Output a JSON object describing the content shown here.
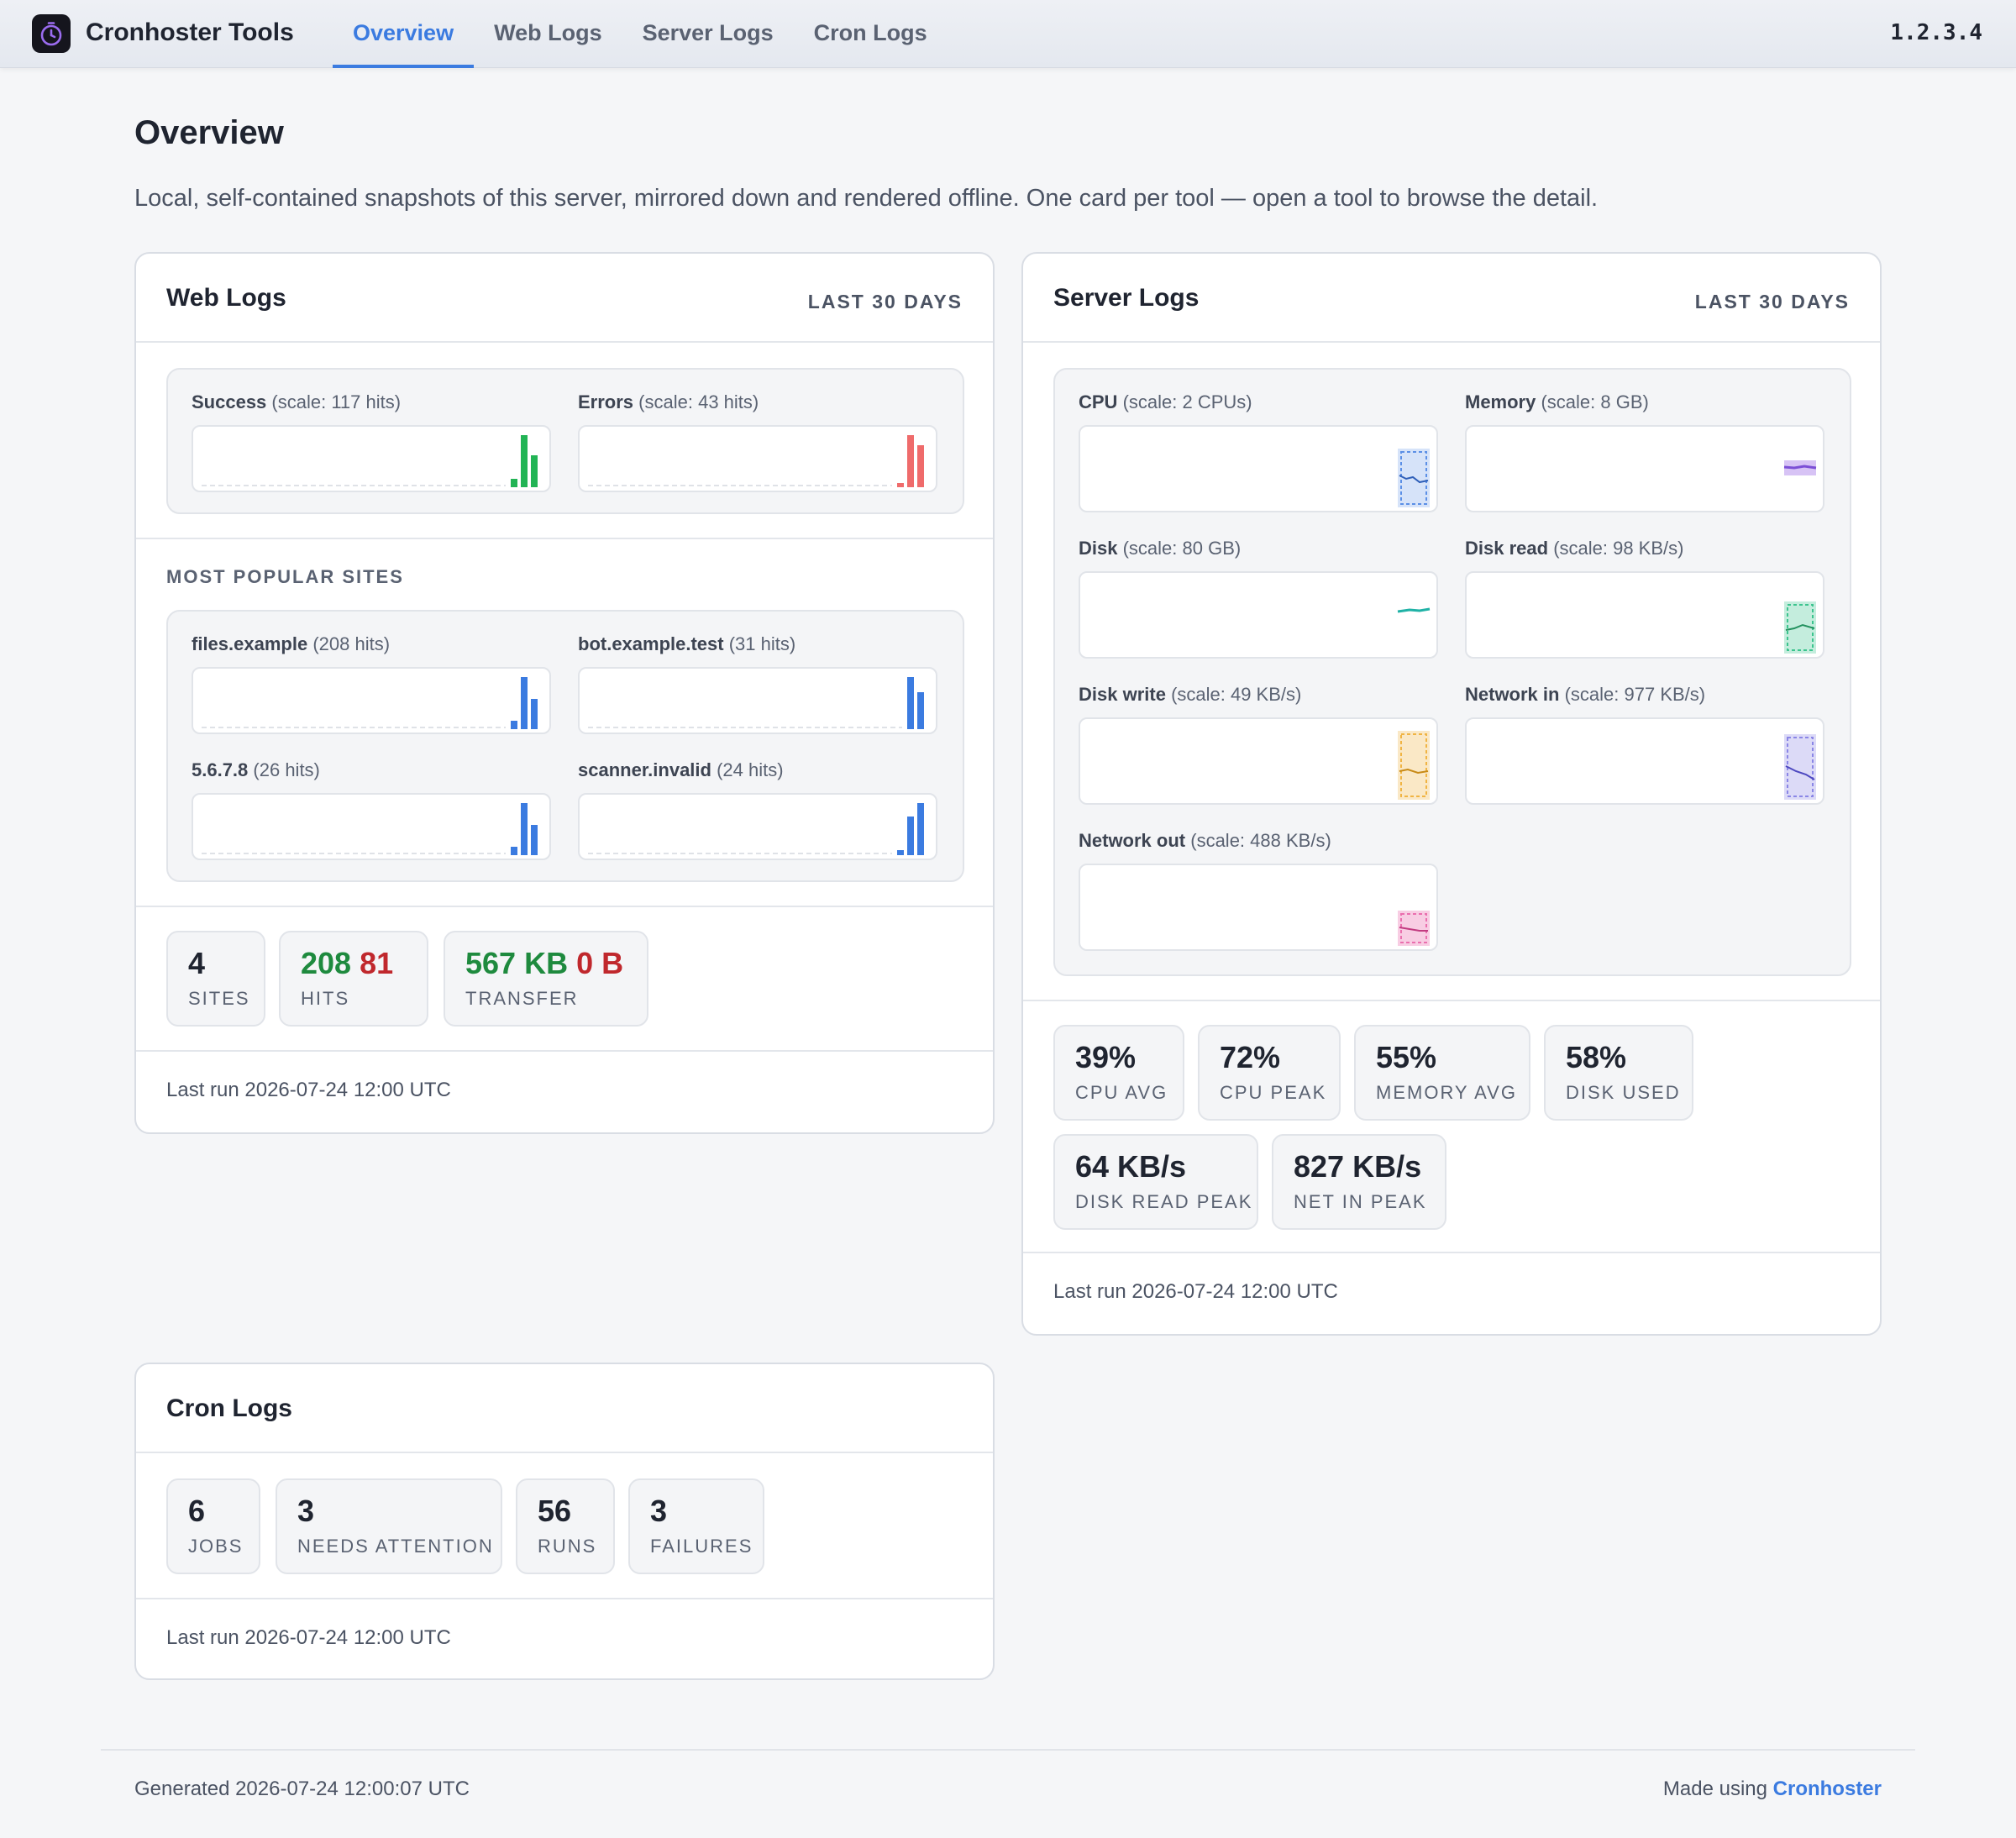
{
  "app": {
    "brand": "Cronhoster Tools",
    "version": "1.2.3.4"
  },
  "nav": {
    "tabs": [
      {
        "label": "Overview",
        "active": true
      },
      {
        "label": "Web Logs"
      },
      {
        "label": "Server Logs"
      },
      {
        "label": "Cron Logs"
      }
    ]
  },
  "page": {
    "title": "Overview",
    "intro": "Local, self-contained snapshots of this server, mirrored down and rendered offline. One card per tool — open a tool to browse the detail."
  },
  "web_logs": {
    "title": "Web Logs",
    "period": "LAST 30 DAYS",
    "sparks": [
      {
        "label": "Success",
        "scale": "(scale: 117 hits)"
      },
      {
        "label": "Errors",
        "scale": "(scale: 43 hits)"
      }
    ],
    "popular_label": "MOST POPULAR SITES",
    "sites": [
      {
        "label": "files.example",
        "scale": "(208 hits)"
      },
      {
        "label": "bot.example.test",
        "scale": "(31 hits)"
      },
      {
        "label": "5.6.7.8",
        "scale": "(26 hits)"
      },
      {
        "label": "scanner.invalid",
        "scale": "(24 hits)"
      }
    ],
    "stats": {
      "sites_value": "4",
      "sites_label": "SITES",
      "hits_ok": "208",
      "hits_err": "81",
      "hits_label": "HITS",
      "transfer_ok": "567 KB",
      "transfer_err": "0 B",
      "transfer_label": "TRANSFER"
    },
    "last_run": "Last run 2026-07-24 12:00 UTC"
  },
  "server_logs": {
    "title": "Server Logs",
    "period": "LAST 30 DAYS",
    "sparks": [
      {
        "label": "CPU",
        "scale": "(scale: 2 CPUs)"
      },
      {
        "label": "Memory",
        "scale": "(scale: 8 GB)"
      },
      {
        "label": "Disk",
        "scale": "(scale: 80 GB)"
      },
      {
        "label": "Disk read",
        "scale": "(scale: 98 KB/s)"
      },
      {
        "label": "Disk write",
        "scale": "(scale: 49 KB/s)"
      },
      {
        "label": "Network in",
        "scale": "(scale: 977 KB/s)"
      },
      {
        "label": "Network out",
        "scale": "(scale: 488 KB/s)"
      }
    ],
    "stats": [
      {
        "value": "39%",
        "label": "CPU AVG"
      },
      {
        "value": "72%",
        "label": "CPU PEAK"
      },
      {
        "value": "55%",
        "label": "MEMORY AVG"
      },
      {
        "value": "58%",
        "label": "DISK USED"
      },
      {
        "value": "64 KB/s",
        "label": "DISK READ PEAK"
      },
      {
        "value": "827 KB/s",
        "label": "NET IN PEAK"
      }
    ],
    "last_run": "Last run 2026-07-24 12:00 UTC"
  },
  "cron_logs": {
    "title": "Cron Logs",
    "stats": [
      {
        "value": "6",
        "label": "JOBS"
      },
      {
        "value": "3",
        "label": "NEEDS ATTENTION"
      },
      {
        "value": "56",
        "label": "RUNS"
      },
      {
        "value": "3",
        "label": "FAILURES"
      }
    ],
    "last_run": "Last run 2026-07-24 12:00 UTC"
  },
  "footer": {
    "generated": "Generated 2026-07-24 12:00:07 UTC",
    "made_using": "Made using",
    "link": "Cronhoster"
  },
  "colors": {
    "accent": "#3b7be0",
    "success": "#22b455",
    "error": "#ef6b6b",
    "cpu": "#5b8fe6",
    "memory": "#a77be8",
    "disk": "#20b2a6",
    "disk_read": "#3cc48e",
    "disk_write": "#f0b443",
    "net_in": "#8a86e6",
    "net_out": "#ea6fae"
  }
}
